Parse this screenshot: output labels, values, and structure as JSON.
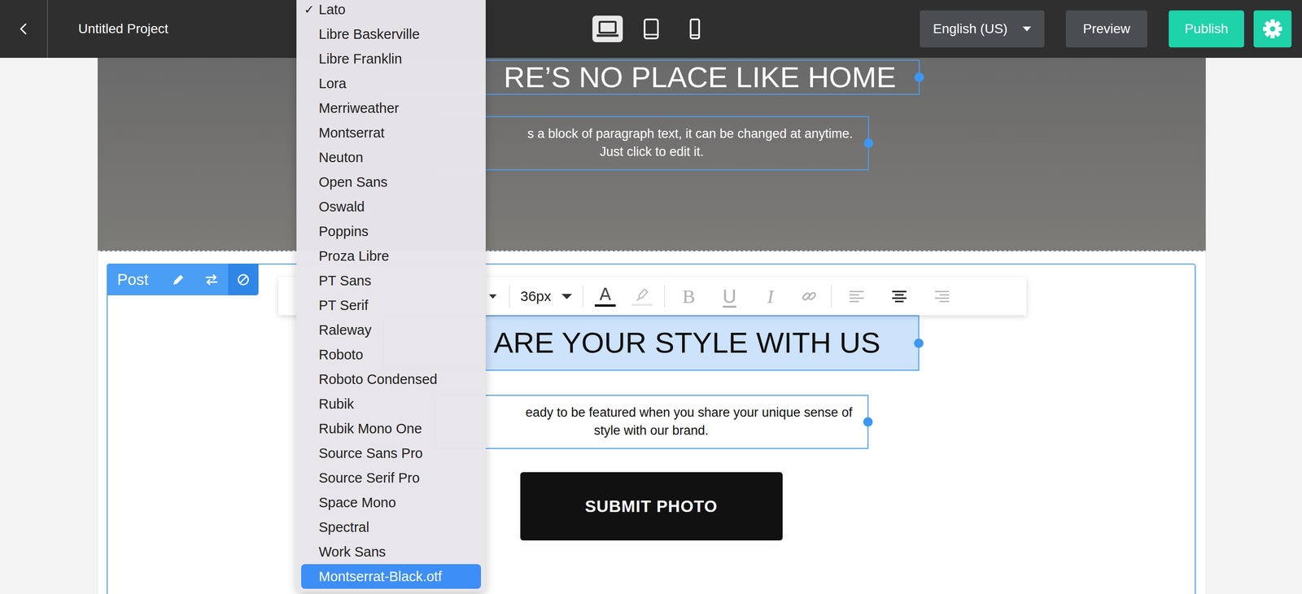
{
  "project_title": "Untitled Project",
  "devices": [
    {
      "kind": "desktop",
      "selected": true
    },
    {
      "kind": "tablet",
      "selected": false
    },
    {
      "kind": "mobile",
      "selected": false
    }
  ],
  "language": "English (US)",
  "buttons": [
    "Preview",
    "Publish"
  ],
  "hero": {
    "heading": "RE’S NO PLACE LIKE HOME",
    "paragraph": [
      "s a block of paragraph text, it can be changed at anytime.",
      "Just click to edit it."
    ]
  },
  "post": {
    "badge": "Post",
    "heading": "ARE YOUR STYLE WITH US",
    "heading_selected": true,
    "paragraph": [
      "eady to be featured when you share your unique sense of",
      "style with our brand."
    ],
    "button": "SUBMIT PHOTO"
  },
  "text_toolbar": {
    "font_size": "36px",
    "text_color_label": "A",
    "formats": [
      {
        "kind": "bold",
        "label": "B",
        "active": false
      },
      {
        "kind": "underline",
        "label": "U",
        "active": false
      },
      {
        "kind": "italic",
        "label": "I",
        "active": false
      }
    ],
    "align": [
      {
        "kind": "left",
        "selected": false
      },
      {
        "kind": "center",
        "selected": true
      },
      {
        "kind": "right",
        "selected": false
      }
    ]
  },
  "font_menu": {
    "check_mark": "✓",
    "items": [
      {
        "label": "Lato",
        "checked": true,
        "highlighted": false
      },
      {
        "label": "Libre Baskerville",
        "checked": false,
        "highlighted": false
      },
      {
        "label": "Libre Franklin",
        "checked": false,
        "highlighted": false
      },
      {
        "label": "Lora",
        "checked": false,
        "highlighted": false
      },
      {
        "label": "Merriweather",
        "checked": false,
        "highlighted": false
      },
      {
        "label": "Montserrat",
        "checked": false,
        "highlighted": false
      },
      {
        "label": "Neuton",
        "checked": false,
        "highlighted": false
      },
      {
        "label": "Open Sans",
        "checked": false,
        "highlighted": false
      },
      {
        "label": "Oswald",
        "checked": false,
        "highlighted": false
      },
      {
        "label": "Poppins",
        "checked": false,
        "highlighted": false
      },
      {
        "label": "Proza Libre",
        "checked": false,
        "highlighted": false
      },
      {
        "label": "PT Sans",
        "checked": false,
        "highlighted": false
      },
      {
        "label": "PT Serif",
        "checked": false,
        "highlighted": false
      },
      {
        "label": "Raleway",
        "checked": false,
        "highlighted": false
      },
      {
        "label": "Roboto",
        "checked": false,
        "highlighted": false
      },
      {
        "label": "Roboto Condensed",
        "checked": false,
        "highlighted": false
      },
      {
        "label": "Rubik",
        "checked": false,
        "highlighted": false
      },
      {
        "label": "Rubik Mono One",
        "checked": false,
        "highlighted": false
      },
      {
        "label": "Source Sans Pro",
        "checked": false,
        "highlighted": false
      },
      {
        "label": "Source Serif Pro",
        "checked": false,
        "highlighted": false
      },
      {
        "label": "Space Mono",
        "checked": false,
        "highlighted": false
      },
      {
        "label": "Spectral",
        "checked": false,
        "highlighted": false
      },
      {
        "label": "Work Sans",
        "checked": false,
        "highlighted": false
      },
      {
        "label": "Montserrat-Black.otf",
        "checked": false,
        "highlighted": true
      }
    ]
  }
}
